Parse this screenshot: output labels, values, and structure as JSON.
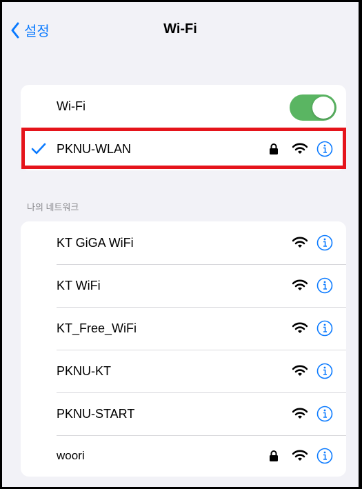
{
  "nav": {
    "back_label": "설정",
    "title": "Wi-Fi"
  },
  "wifi_toggle": {
    "label": "Wi-Fi",
    "on": true
  },
  "connected_network": {
    "name": "PKNU-WLAN",
    "secured": true,
    "selected": true
  },
  "section_header": "나의 네트워크",
  "networks": [
    {
      "name": "KT GiGA WiFi",
      "secured": false
    },
    {
      "name": "KT WiFi",
      "secured": false
    },
    {
      "name": "KT_Free_WiFi",
      "secured": false
    },
    {
      "name": "PKNU-KT",
      "secured": false
    },
    {
      "name": "PKNU-START",
      "secured": false
    },
    {
      "name": "woori",
      "secured": true
    }
  ],
  "icons": {
    "back": "chevron-left-icon",
    "check": "checkmark-icon",
    "lock": "lock-icon",
    "wifi": "wifi-signal-icon",
    "info": "info-circle-icon"
  },
  "colors": {
    "accent": "#0a7aff",
    "toggle_on": "#5ab562",
    "highlight": "#e5141b",
    "background": "#f2f2f7"
  }
}
